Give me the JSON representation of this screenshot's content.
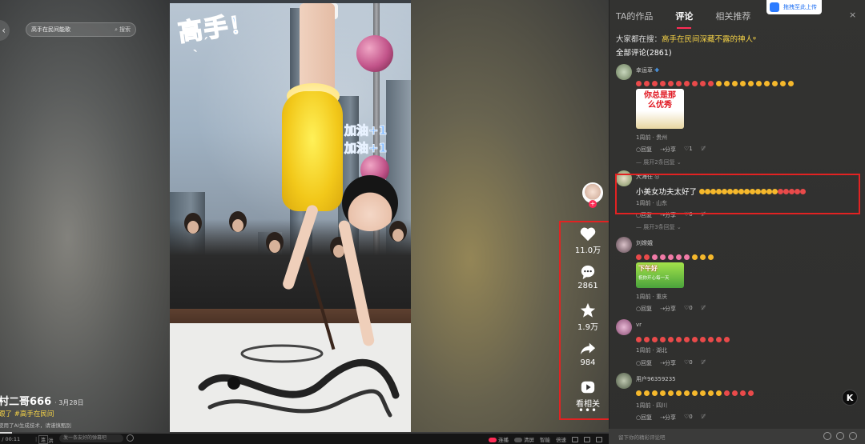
{
  "search": {
    "query": "高手在民间能歌",
    "button_label": "搜索"
  },
  "video": {
    "overlay_title": "高手",
    "overlay_bang": "！",
    "overlay_lines": [
      "加油+1",
      "加油+1"
    ]
  },
  "actions": [
    {
      "icon": "heart-icon",
      "label": "11.0万"
    },
    {
      "icon": "comment-icon",
      "label": "2861"
    },
    {
      "icon": "star-icon",
      "label": "1.9万"
    },
    {
      "icon": "share-icon",
      "label": "984"
    },
    {
      "icon": "play-related-icon",
      "label": "看相关"
    }
  ],
  "author": {
    "name": "村二哥666",
    "date": "· 3月28日"
  },
  "description": {
    "prefix": "跟了 ",
    "tag": "#高手在民间"
  },
  "ai_note": "使用了AI生成技术，请谨慎甄别",
  "controls": {
    "time": "1 / 00:11",
    "lian": "连",
    "lian2": "洪",
    "danmu_placeholder": "发一条友好的弹幕吧",
    "toggles": [
      "连播",
      "清屏",
      "智能",
      "倍速"
    ],
    "progress": 0.02
  },
  "panel": {
    "tabs": [
      "TA的作品",
      "评论",
      "相关推荐"
    ],
    "active_tab": 1,
    "upload_label": "拖拽至此上传",
    "close": "×",
    "hot_prefix": "大家都在搜：",
    "hot_keyword": "高手在民间深藏不露的神人",
    "hot_icon": "ᵠ",
    "count_label": "全部评论(2861)",
    "input_placeholder": "留下你的精彩评论吧"
  },
  "comments": [
    {
      "name": "幸运草",
      "meta": "1周前 · 贵州",
      "sticker_text": [
        "你总是那",
        "么优秀"
      ],
      "reply": "回复",
      "share": "分享",
      "likes": "1",
      "expand": "展开2条回复"
    },
    {
      "name": "大海任",
      "text": "小美女功夫太好了",
      "meta": "1周前 · 山东",
      "reply": "回复",
      "share": "分享",
      "likes": "0",
      "expand": "展开3条回复"
    },
    {
      "name": "刘嫦娥",
      "meta": "1周前 · 重庆",
      "sticker_text": [
        "下午好",
        "祝你开心每一天"
      ],
      "reply": "回复",
      "share": "分享",
      "likes": "0"
    },
    {
      "name": "vr",
      "meta": "1周前 · 湖北",
      "reply": "回复",
      "share": "分享",
      "likes": "0"
    },
    {
      "name": "用户96359235",
      "meta": "1周前 · 四川",
      "reply": "回复",
      "share": "分享",
      "likes": "0"
    }
  ],
  "colors": {
    "accent": "#fe2c55",
    "highlight_box": "#e22222",
    "hashtag": "#f7d447"
  }
}
